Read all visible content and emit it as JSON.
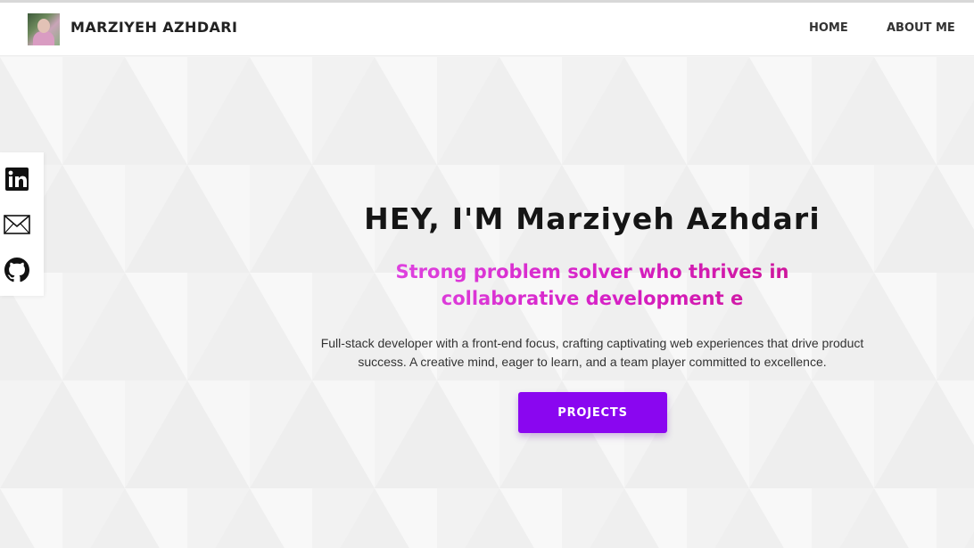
{
  "header": {
    "brand": "MARZIYEH AZHDARI",
    "nav": [
      {
        "label": "HOME"
      },
      {
        "label": "ABOUT ME"
      }
    ]
  },
  "social": {
    "icons": [
      "linkedin-icon",
      "mail-icon",
      "github-icon"
    ]
  },
  "hero": {
    "title": "HEY, I'M Marziyeh Azhdari",
    "subtitle": "Strong problem solver who thrives in collaborative development e",
    "description": "Full-stack developer with a front-end focus, crafting captivating web experiences that drive product success. A creative mind, eager to learn, and a team player committed to excellence.",
    "button_label": "PROJECTS"
  },
  "colors": {
    "accent": "#8a06f0",
    "subtitle_start": "#e04be6",
    "subtitle_end": "#cc148f",
    "background": "#f5f5f5"
  }
}
